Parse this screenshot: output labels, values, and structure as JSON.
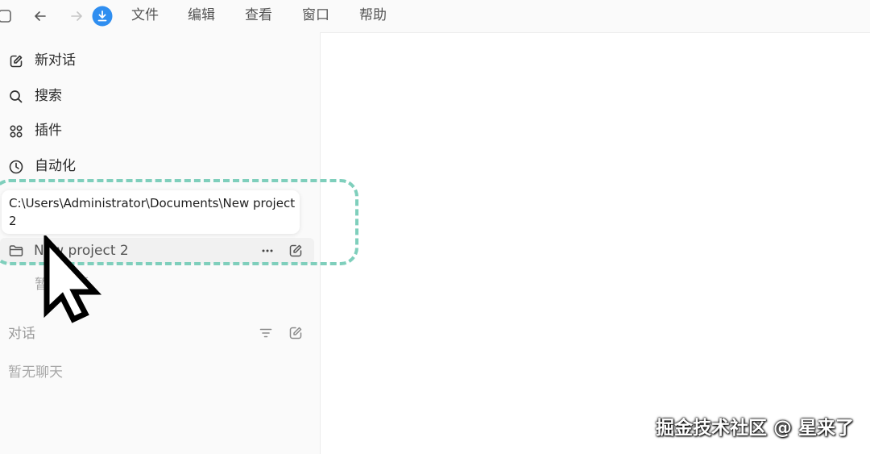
{
  "menu": {
    "items": [
      {
        "label": "文件"
      },
      {
        "label": "编辑"
      },
      {
        "label": "查看"
      },
      {
        "label": "窗口"
      },
      {
        "label": "帮助"
      }
    ]
  },
  "icons": {
    "sidebar_toggle": "sidebar-toggle-icon",
    "back": "arrow-left-icon",
    "forward": "arrow-right-icon",
    "download": "download-icon",
    "accent_color": "#2f8ef0"
  },
  "sidebar": {
    "nav": [
      {
        "label": "新对话",
        "icon": "edit-icon"
      },
      {
        "label": "搜索",
        "icon": "search-icon"
      },
      {
        "label": "插件",
        "icon": "plugins-icon"
      },
      {
        "label": "自动化",
        "icon": "clock-icon"
      }
    ],
    "tooltip": {
      "line1": "C:\\Users\\Administrator\\Documents\\New project",
      "line2": "2"
    },
    "project": {
      "label": "New project 2",
      "icon": "folder-icon",
      "more_icon": "more-icon",
      "new_chat_icon": "edit-icon"
    },
    "project_empty": "暂无对话",
    "chats_section": {
      "label": "对话",
      "filter_icon": "filter-icon",
      "new_icon": "edit-icon",
      "empty": "暂无聊天"
    }
  },
  "overlay": {
    "highlight_color": "#7fcfbc",
    "watermark": "掘金技术社区 @ 星来了"
  }
}
